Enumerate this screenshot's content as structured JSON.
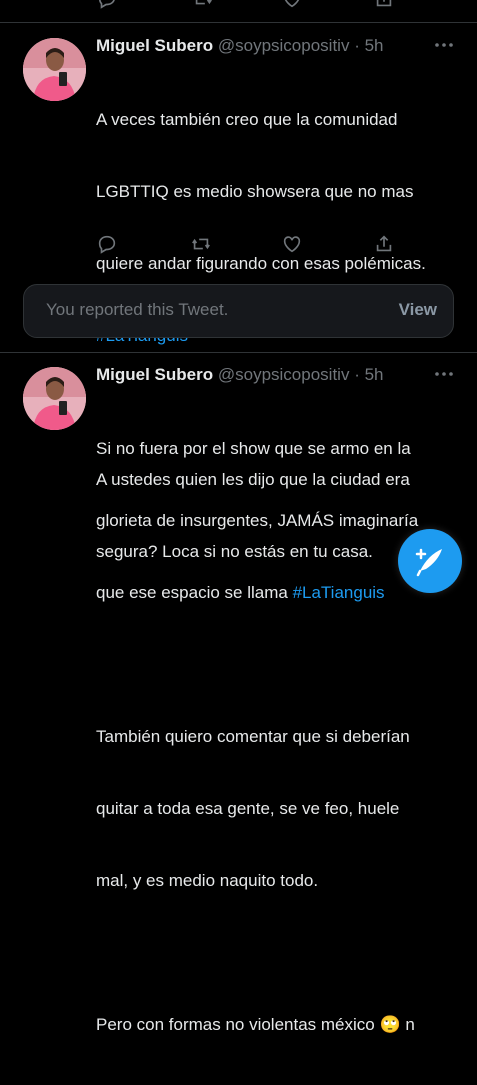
{
  "tweets": [
    {
      "name": "Miguel Subero",
      "handle": "@soypsicopositiv",
      "sep": "·",
      "time": "5h",
      "line1": "A veces también creo que la comunidad",
      "line2": "LGBTTIQ es medio showsera que no mas",
      "line3": "quiere andar figurando con esas polémicas.",
      "hashtag": "#LaTianguis",
      "line5": "A ustedes quien les dijo que la ciudad era",
      "line6": "segura? Loca si no estás en tu casa."
    },
    {
      "name": "Miguel Subero",
      "handle": "@soypsicopositiv",
      "sep": "·",
      "time": "5h",
      "line1": "Si no fuera por el show que se armo en la",
      "line2": "glorieta de insurgentes, JAMÁS imaginaría",
      "line3": "que ese espacio se llama ",
      "hashtag": "#LaTianguis",
      "line5": "También quiero comentar que si deberían",
      "line6": "quitar a toda esa gente, se ve feo, huele",
      "line7": "mal, y es medio naquito todo.",
      "line9": "Pero con formas no violentas méxico 🙄 n"
    }
  ],
  "report_banner": {
    "text": "You reported this Tweet.",
    "action": "View"
  },
  "icons": {
    "reply": "reply-icon",
    "retweet": "retweet-icon",
    "like": "like-icon",
    "share": "share-icon",
    "more": "more-icon",
    "compose": "compose-tweet-icon"
  },
  "colors": {
    "background": "#000000",
    "accent": "#1d9bf0",
    "secondary_text": "#71767b"
  }
}
